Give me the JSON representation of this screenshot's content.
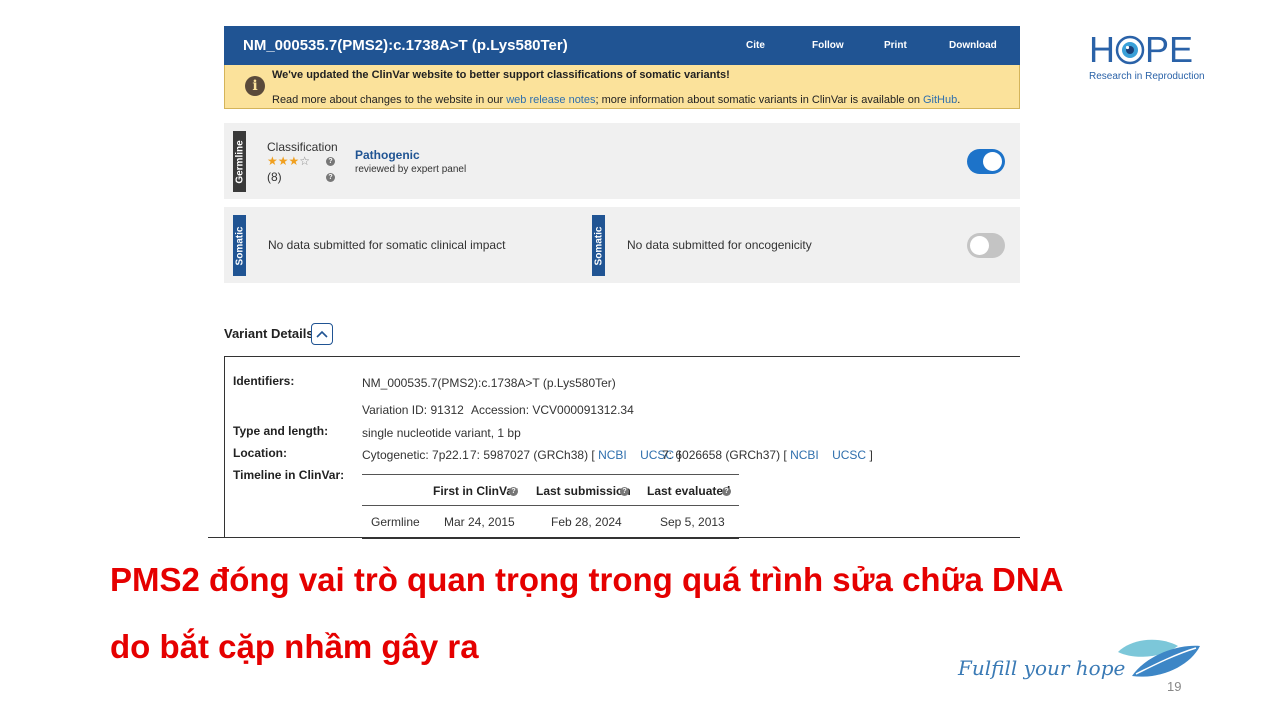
{
  "header": {
    "title": "NM_000535.7(PMS2):c.1738A>T (p.Lys580Ter)",
    "actions": [
      "Cite",
      "Follow",
      "Print",
      "Download"
    ]
  },
  "notice": {
    "headline": "We've updated the ClinVar website to better support classifications of somatic variants!",
    "line_prefix": "Read more about changes to the website in our ",
    "link1": "web release notes",
    "line_middle": "; more information about somatic variants in ClinVar is available on ",
    "link2": "GitHub",
    "line_suffix": "."
  },
  "germline": {
    "tag": "Germline",
    "classification_label": "Classification",
    "stars_filled": 3,
    "stars_total": 4,
    "submission_count": "(8)",
    "status": "Pathogenic",
    "review": "reviewed by expert panel",
    "toggle_on": true
  },
  "somatic": {
    "tag": "Somatic",
    "clinical_impact": "No data submitted for somatic clinical impact",
    "oncogenicity": "No data submitted for oncogenicity",
    "toggle_on": false
  },
  "variant_details": {
    "title": "Variant Details",
    "identifiers_label": "Identifiers:",
    "identifiers_value": "NM_000535.7(PMS2):c.1738A>T (p.Lys580Ter)",
    "variation_id": "Variation ID: 91312",
    "accession": "Accession: VCV000091312.34",
    "type_label": "Type and length:",
    "type_value": "single nucleotide variant, 1 bp",
    "location_label": "Location:",
    "cytogenetic": "Cytogenetic: 7p22.1",
    "grch38": "7: 5987027 (GRCh38) [ ",
    "grch37": "7: 6026658 (GRCh37) [ ",
    "link_ncbi": "NCBI",
    "link_ucsc": "UCSC",
    "bracket_close": " ]",
    "timeline_label": "Timeline in ClinVar:",
    "timeline": {
      "headers": [
        "First in ClinVar",
        "Last submission",
        "Last evaluated"
      ],
      "row": {
        "type": "Germline",
        "first": "Mar 24, 2015",
        "last_submission": "Feb 28, 2024",
        "last_evaluated": "Sep 5, 2013"
      }
    }
  },
  "slide": {
    "line1": "PMS2 đóng vai trò quan trọng trong quá trình sửa chữa DNA",
    "line2": "do bắt cặp nhầm gây ra",
    "logo_text_h": "H",
    "logo_text_pe": "PE",
    "logo_subtitle": "Research in Reproduction",
    "tagline": "Fulfill your hope",
    "page_number": "19"
  },
  "colors": {
    "header_blue": "#205493",
    "notice_yellow": "#fbe29b",
    "toggle_on": "#1d73c9",
    "slide_red": "#e50000",
    "logo_blue": "#2a62a8"
  }
}
